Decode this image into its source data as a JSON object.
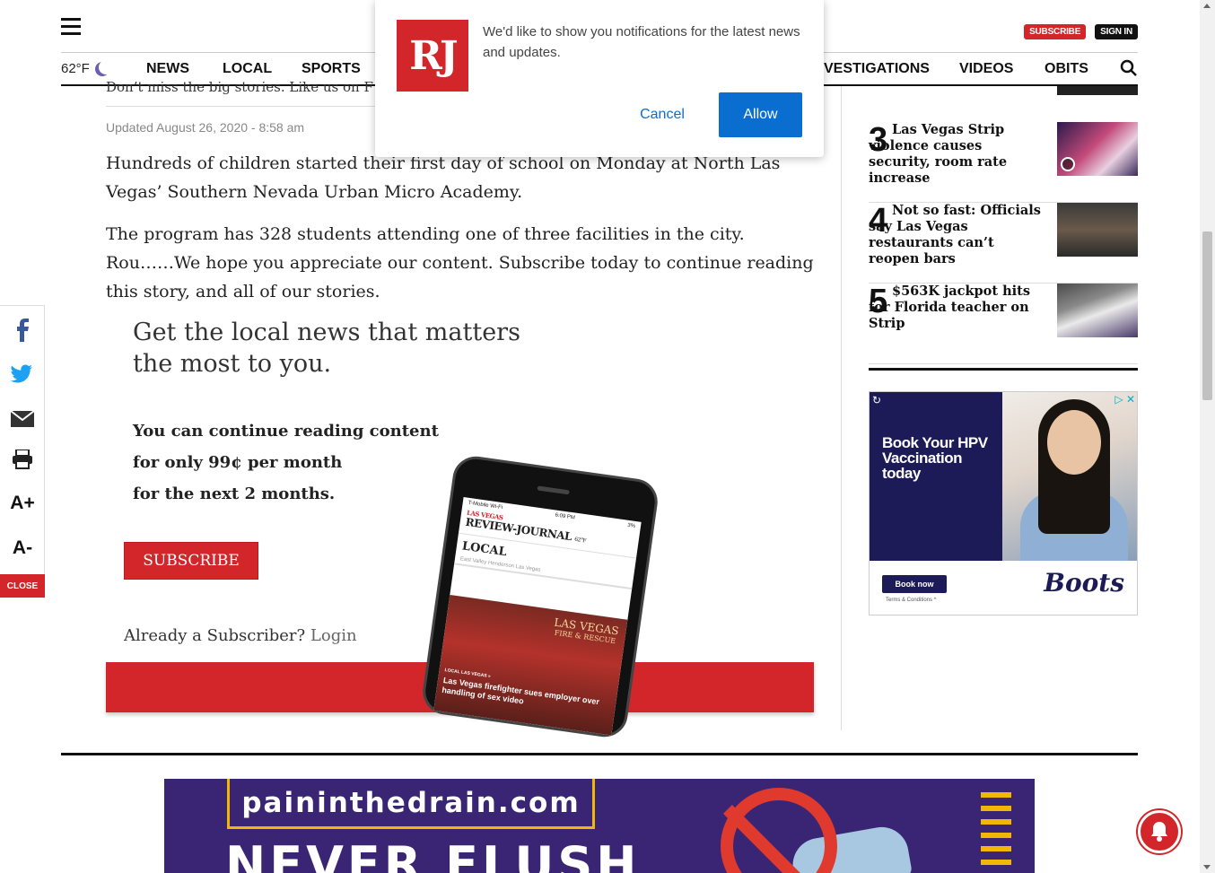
{
  "header": {
    "subscribe_label": "SUBSCRIBE",
    "signin_label": "SIGN IN",
    "weather": "62°F",
    "nav": [
      "NEWS",
      "LOCAL",
      "SPORTS",
      "VESTIGATIONS",
      "VIDEOS",
      "OBITS"
    ]
  },
  "article": {
    "clipped_line": "Don’t miss the big stories. Like us on F",
    "updated": "Updated August 26, 2020 - 8:58 am",
    "para1": "Hundreds of children started their first day of school on Monday at North Las Vegas’ Southern Nevada Urban Micro Academy.",
    "para2": "The program has 328 students attending one of three facilities in the city. Rou……We hope you appreciate our content. Subscribe today to continue reading this story, and all of our stories."
  },
  "paywall": {
    "heading_line1": "Get the local news that matters",
    "heading_line2": "the most to you.",
    "offer_line1": "You can continue reading content",
    "offer_line2": "for only 99¢ per month",
    "offer_line3": "for the next 2 months.",
    "subscribe_button": "SUBSCRIBE",
    "already_text": "Already a Subscriber?",
    "login_link": "Login",
    "phone": {
      "carrier": "T-Mobile Wi-Fi",
      "time": "6:09 PM",
      "battery": "3%",
      "logo_top": "LAS VEGAS",
      "logo_main": "REVIEW-JOURNAL",
      "temp": "62°F",
      "section": "LOCAL",
      "subnav": "East Valley   Henderson   Las Vegas",
      "photo_title": "LAS VEGAS",
      "photo_subtitle": "FIRE & RESCUE",
      "caption_kicker": "LOCAL LAS VEGAS »",
      "caption": "Las Vegas firefighter sues employer over handling of sex video"
    }
  },
  "share": {
    "font_plus": "A+",
    "font_minus": "A-",
    "close": "CLOSE"
  },
  "sidebar": {
    "items": [
      {
        "num": "3",
        "title": "Las Vegas Strip violence causes security, room rate increase"
      },
      {
        "num": "4",
        "title": "Not so fast: Officials say Las Vegas restaurants can’t reopen bars"
      },
      {
        "num": "5",
        "title": "$563K jackpot hits for Florida teacher on Strip"
      }
    ]
  },
  "ad": {
    "headline_1": "Book Your HPV",
    "headline_2": "Vaccination",
    "headline_3": "today",
    "button": "Book now",
    "terms": "Terms & Conditions ^",
    "brand": "Boots"
  },
  "banner": {
    "url": "paininthedrain.com",
    "headline": "NEVER FLUSH"
  },
  "popup": {
    "logo": "RJ",
    "message": "We'd like to show you notifications for the latest news and updates.",
    "cancel": "Cancel",
    "allow": "Allow"
  },
  "colors": {
    "brand_red": "#d3262a",
    "allow_blue": "#0a6ed1",
    "ad_navy": "#1c1b57",
    "banner_purple": "#3a2575"
  }
}
